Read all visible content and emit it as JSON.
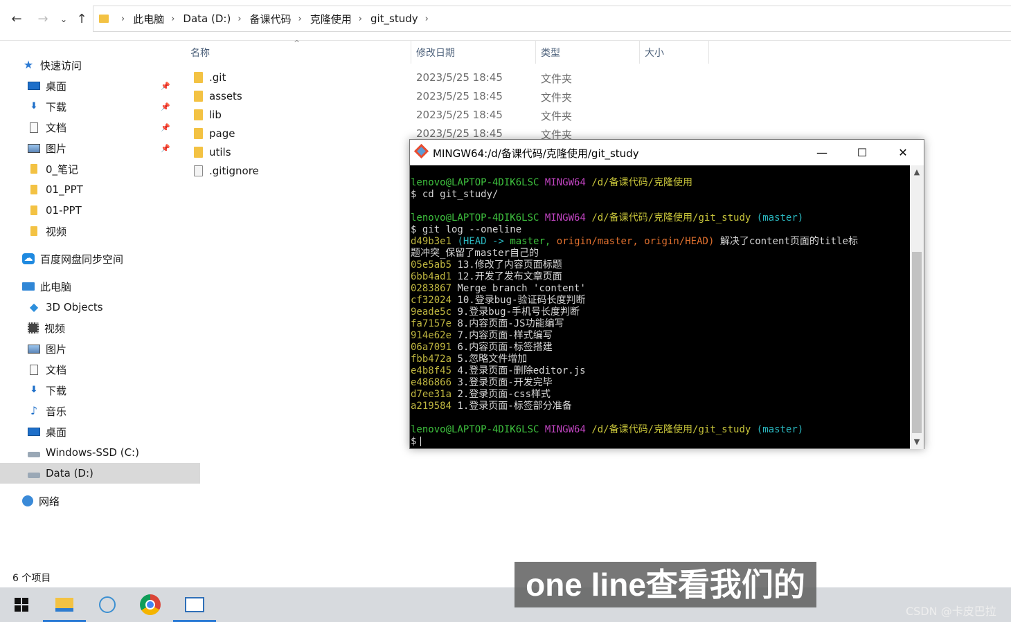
{
  "address_bar": {
    "crumbs": [
      "此电脑",
      "Data (D:)",
      "备课代码",
      "克隆使用",
      "git_study"
    ]
  },
  "sidebar": {
    "quick_access": "快速访问",
    "quick_items": [
      "桌面",
      "下载",
      "文档",
      "图片",
      "0_笔记",
      "01_PPT",
      "01-PPT",
      "视频"
    ],
    "baidu": "百度网盘同步空间",
    "this_pc": "此电脑",
    "pc_items": [
      "3D Objects",
      "视频",
      "图片",
      "文档",
      "下载",
      "音乐",
      "桌面",
      "Windows-SSD (C:)",
      "Data (D:)"
    ],
    "network": "网络"
  },
  "columns": {
    "name": "名称",
    "date": "修改日期",
    "type": "类型",
    "size": "大小"
  },
  "files": [
    {
      "name": ".git",
      "date": "2023/5/25 18:45",
      "type": "文件夹"
    },
    {
      "name": "assets",
      "date": "2023/5/25 18:45",
      "type": "文件夹"
    },
    {
      "name": "lib",
      "date": "2023/5/25 18:45",
      "type": "文件夹"
    },
    {
      "name": "page",
      "date": "2023/5/25 18:45",
      "type": "文件夹"
    },
    {
      "name": "utils",
      "date": "",
      "type": ""
    },
    {
      "name": ".gitignore",
      "date": "",
      "type": ""
    }
  ],
  "status": {
    "count": "6 个项目"
  },
  "terminal": {
    "title": "MINGW64:/d/备课代码/克隆使用/git_study",
    "prompt_user": "lenovo@LAPTOP-4DIK6LSC",
    "prompt_env": "MINGW64",
    "path1": "/d/备课代码/克隆使用",
    "path2": "/d/备课代码/克隆使用/git_study",
    "branch": "(master)",
    "cmd1": "$ cd git_study/",
    "cmd2": "$ git log --oneline",
    "head_hash": "d49b3e1",
    "head_ref_open": "(HEAD ->",
    "head_master": "master,",
    "head_origin_master": "origin/master,",
    "head_origin_head": "origin/HEAD)",
    "head_msg": "解决了content页面的title标",
    "head_msg_cont": "题冲突_保留了master自己的",
    "commits": [
      {
        "hash": "05e5ab5",
        "msg": "13.修改了内容页面标题"
      },
      {
        "hash": "6bb4ad1",
        "msg": "12.开发了发布文章页面"
      },
      {
        "hash": "0283867",
        "msg": "Merge branch 'content'"
      },
      {
        "hash": "cf32024",
        "msg": "10.登录bug-验证码长度判断"
      },
      {
        "hash": "9eade5c",
        "msg": "9.登录bug-手机号长度判断"
      },
      {
        "hash": "fa7157e",
        "msg": "8.内容页面-JS功能编写"
      },
      {
        "hash": "914e62e",
        "msg": "7.内容页面-样式编写"
      },
      {
        "hash": "06a7091",
        "msg": "6.内容页面-标签搭建"
      },
      {
        "hash": "fbb472a",
        "msg": "5.忽略文件增加"
      },
      {
        "hash": "e4b8f45",
        "msg": "4.登录页面-删除editor.js"
      },
      {
        "hash": "e486866",
        "msg": "3.登录页面-开发完毕"
      },
      {
        "hash": "d7ee31a",
        "msg": "2.登录页面-css样式"
      },
      {
        "hash": "a219584",
        "msg": "1.登录页面-标签部分准备"
      }
    ],
    "final_prompt": "$"
  },
  "subtitle": "one line查看我们的",
  "watermark": "CSDN @卡皮巴拉"
}
